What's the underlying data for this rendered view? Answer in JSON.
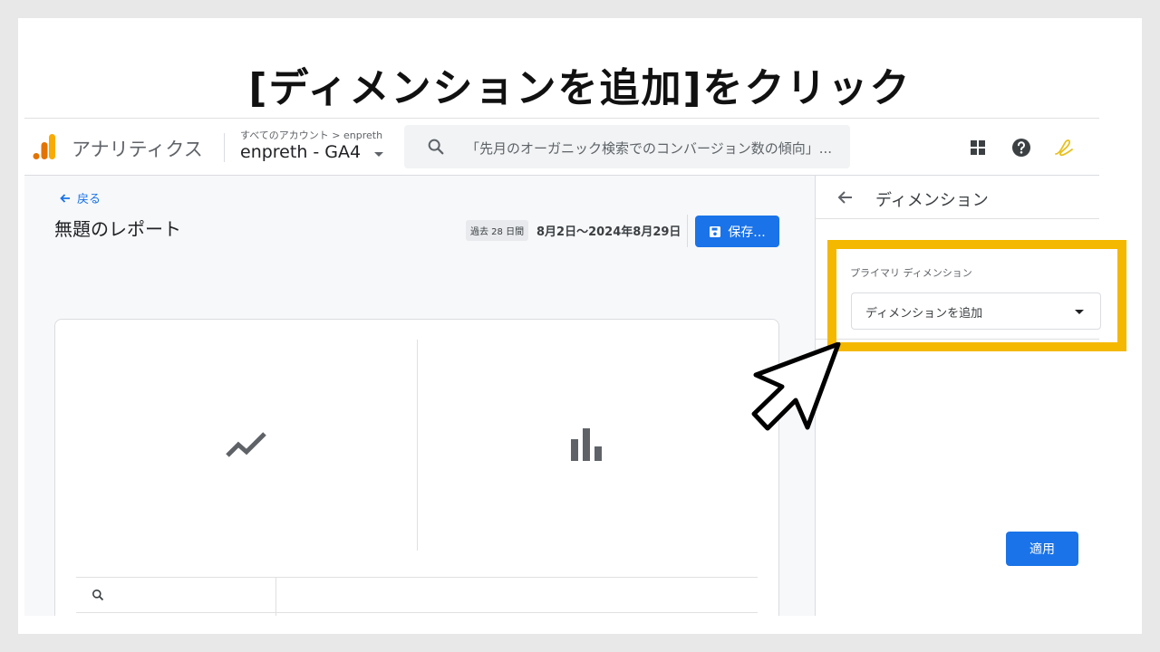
{
  "slide": {
    "title": "[ディメンションを追加]をクリック"
  },
  "header": {
    "app_name": "アナリティクス",
    "account_path": "すべてのアカウント > enpreth",
    "property_name": "enpreth - GA4",
    "search_placeholder": "「先月のオーガニック検索でのコンバージョン数の傾向」...",
    "icons": [
      "apps-icon",
      "help-icon",
      "account-icon"
    ]
  },
  "report": {
    "back_label": "戻る",
    "title": "無題のレポート",
    "date_chip": "過去 28 日間",
    "date_range": "8月2日～2024年8月29日",
    "save_label": "保存..."
  },
  "panel": {
    "title": "ディメンション",
    "primary_dimension_label": "プライマリ ディメンション",
    "dropdown_value": "ディメンションを追加",
    "apply_label": "適用"
  },
  "colors": {
    "accent": "#1a73e8",
    "highlight": "#f5b800",
    "logo_orange": "#f9ab00",
    "logo_dark": "#e37400"
  }
}
